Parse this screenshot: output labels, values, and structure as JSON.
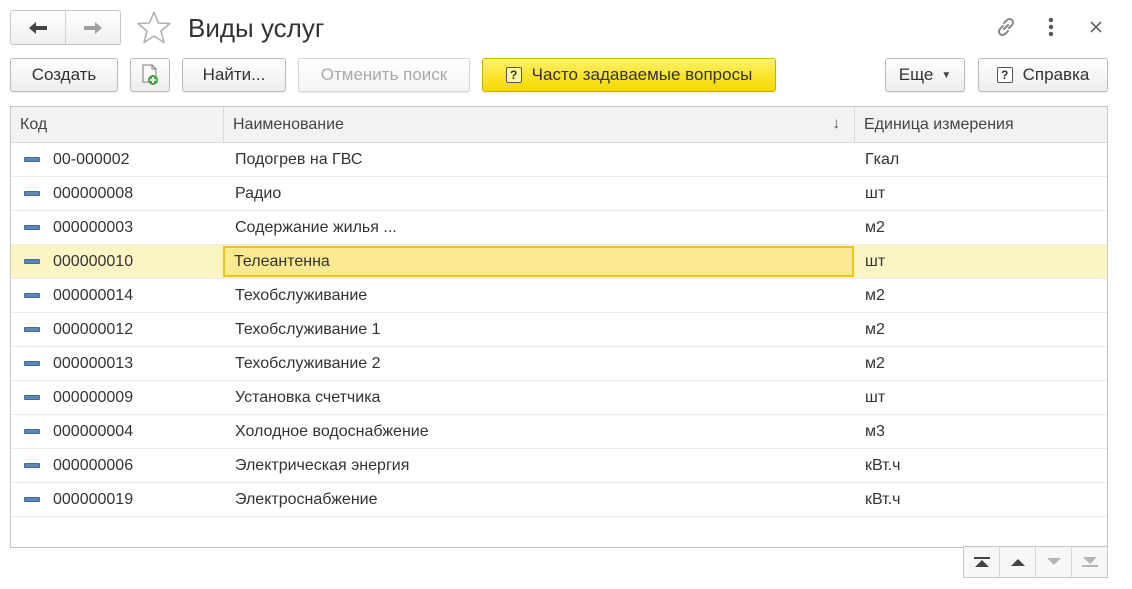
{
  "window": {
    "title": "Виды услуг",
    "back_icon": "arrow-left-icon",
    "forward_icon": "arrow-right-icon",
    "favorite_icon": "star-icon",
    "link_icon": "link-icon",
    "more_icon": "more-vertical-icon",
    "close_icon": "close-icon"
  },
  "toolbar": {
    "create_label": "Создать",
    "create_copy_icon": "add-document-icon",
    "find_label": "Найти...",
    "cancel_search_label": "Отменить поиск",
    "faq_icon": "?",
    "faq_label": "Часто задаваемые вопросы",
    "more_label": "Еще",
    "help_icon": "?",
    "help_label": "Справка"
  },
  "table": {
    "columns": [
      "Код",
      "Наименование",
      "Единица измерения"
    ],
    "sort_indicator": "↓",
    "rows": [
      {
        "code": "00-000002",
        "name": "Подогрев на ГВС",
        "unit": "Гкал"
      },
      {
        "code": "000000008",
        "name": "Радио",
        "unit": "шт"
      },
      {
        "code": "000000003",
        "name": "Содержание жилья ...",
        "unit": "м2"
      },
      {
        "code": "000000010",
        "name": "Телеантенна",
        "unit": "шт"
      },
      {
        "code": "000000014",
        "name": "Техобслуживание",
        "unit": "м2"
      },
      {
        "code": "000000012",
        "name": "Техобслуживание 1",
        "unit": "м2"
      },
      {
        "code": "000000013",
        "name": "Техобслуживание 2",
        "unit": "м2"
      },
      {
        "code": "000000009",
        "name": "Установка счетчика",
        "unit": "шт"
      },
      {
        "code": "000000004",
        "name": "Холодное водоснабжение",
        "unit": "м3"
      },
      {
        "code": "000000006",
        "name": "Электрическая энергия",
        "unit": "кВт.ч"
      },
      {
        "code": "000000019",
        "name": "Электроснабжение",
        "unit": "кВт.ч"
      }
    ],
    "selected_row": 3,
    "row_icon": "catalog-item-icon"
  },
  "scroll": {
    "icons": [
      "scroll-to-top-icon",
      "scroll-up-icon",
      "scroll-down-icon",
      "scroll-to-bottom-icon"
    ]
  },
  "colors": {
    "accent_yellow": "#f5d800",
    "selected_row": "#fdf4c4",
    "selected_cell_border": "#f0c419"
  }
}
